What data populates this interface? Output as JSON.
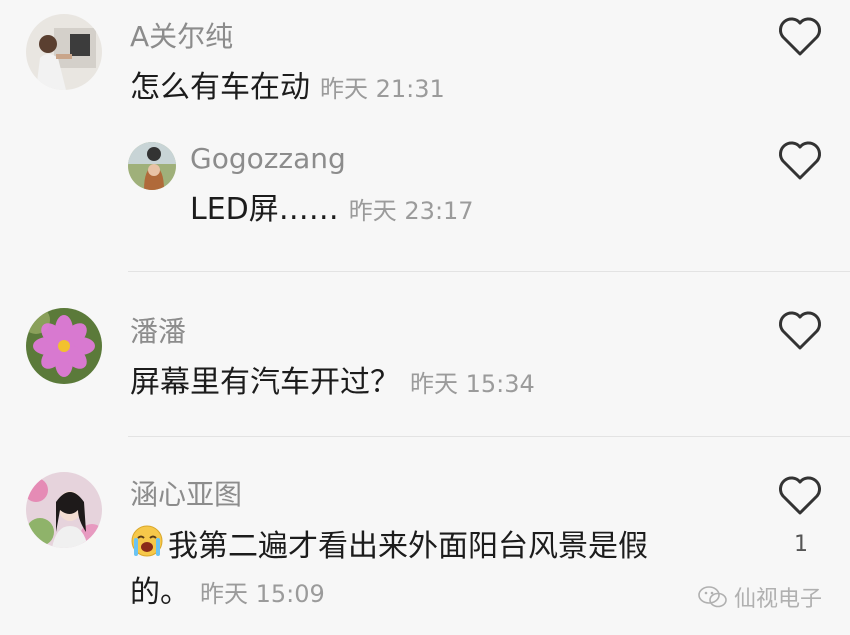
{
  "comments": [
    {
      "user": "A关尔纯",
      "text": "怎么有车在动",
      "time": "昨天 21:31",
      "replies": [
        {
          "user": "Gogozzang",
          "text": "LED屏……",
          "time": "昨天 23:17"
        }
      ]
    },
    {
      "user": "潘潘",
      "text": "屏幕里有汽车开过？",
      "time": "昨天 15:34"
    },
    {
      "user": "涵心亚图",
      "text_line1": "我第二遍才看出来外面阳台风景是假",
      "text_line2": "的。",
      "time": "昨天 15:09",
      "likes": "1",
      "emoji": "crying-face-emoji"
    }
  ],
  "watermark": "仙视电子",
  "icons": [
    "heart-outline-icon",
    "wechat-icon"
  ]
}
